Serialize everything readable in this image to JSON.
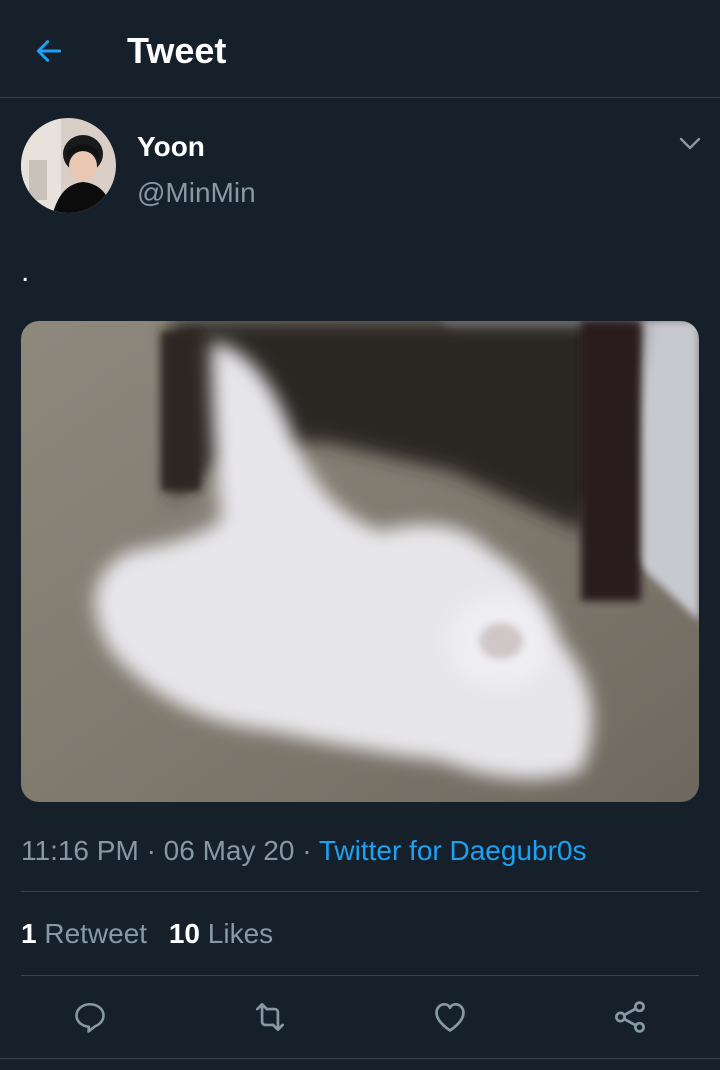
{
  "header": {
    "title": "Tweet",
    "back_icon": "arrow-left-icon"
  },
  "author": {
    "name": "Yoon",
    "handle": "@MinMin"
  },
  "tweet": {
    "text": ".",
    "time": "11:16 PM",
    "date": "06 May 20",
    "separator": "·",
    "source": "Twitter for Daegubr0s"
  },
  "stats": {
    "retweets_count": "1",
    "retweets_label": "Retweet",
    "likes_count": "10",
    "likes_label": "Likes"
  },
  "actions": [
    {
      "name": "reply",
      "icon": "reply-icon"
    },
    {
      "name": "retweet",
      "icon": "retweet-icon"
    },
    {
      "name": "like",
      "icon": "heart-icon"
    },
    {
      "name": "share",
      "icon": "share-icon"
    }
  ],
  "colors": {
    "background": "#15202b",
    "accent": "#1da1f2",
    "secondary_text": "#8899a6",
    "divider": "#38444d"
  }
}
